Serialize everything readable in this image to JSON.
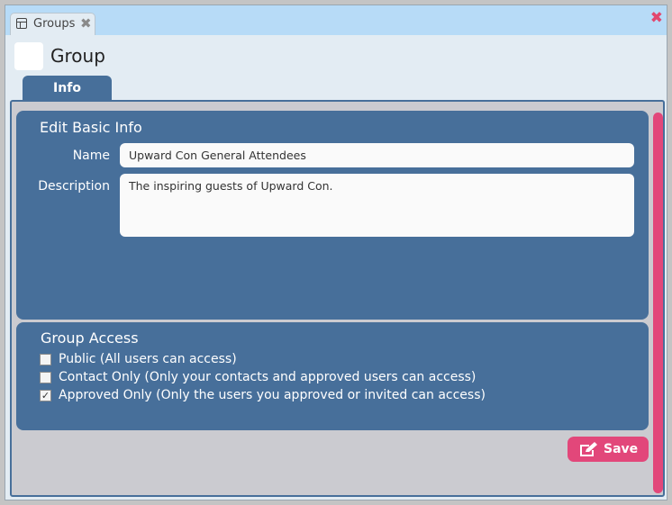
{
  "window": {
    "tab_label": "Groups",
    "tab_icon": "window-icon",
    "close_icon": "close-icon"
  },
  "header": {
    "title": "Group"
  },
  "tabs": [
    {
      "label": "Info",
      "active": true
    }
  ],
  "basic_info": {
    "title": "Edit Basic Info",
    "name_label": "Name",
    "name_value": "Upward Con General Attendees",
    "description_label": "Description",
    "description_value": "The inspiring guests of Upward Con."
  },
  "access": {
    "title": "Group Access",
    "options": [
      {
        "label": "Public (All users can access)",
        "checked": false
      },
      {
        "label": "Contact Only (Only your contacts and approved users can access)",
        "checked": false
      },
      {
        "label": "Approved Only (Only the users you approved or invited can access)",
        "checked": true
      }
    ]
  },
  "save_button": {
    "label": "Save",
    "icon": "edit-icon"
  },
  "colors": {
    "accent": "#e2477a",
    "panel": "#476f9a",
    "titlebar": "#b7dbf7"
  }
}
